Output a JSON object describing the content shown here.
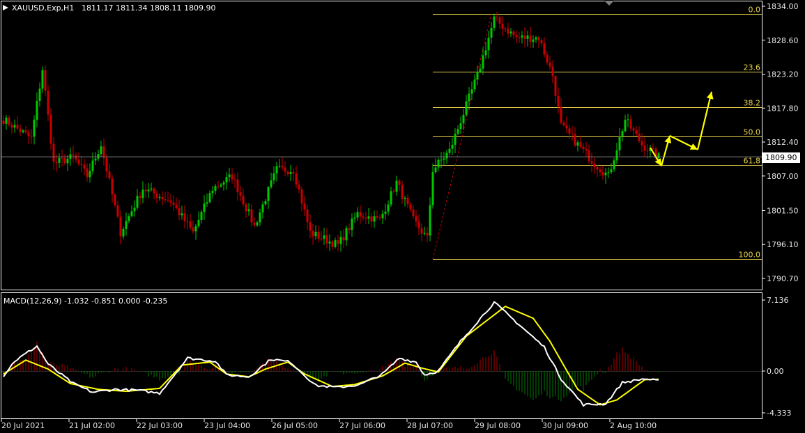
{
  "header": {
    "symbol": "XAUUSD.Exp,H1",
    "ohlc": "1811.17 1811.34 1808.11 1809.90"
  },
  "macd": {
    "label": "MACD(12,26,9) -1.032 -0.851 0.000 -0.235",
    "axis_labels": [
      "7.136",
      "0.00",
      "-4.333"
    ]
  },
  "price_axis_labels": [
    "1834.00",
    "1828.60",
    "1823.20",
    "1817.80",
    "1812.40",
    "1807.00",
    "1801.50",
    "1796.10",
    "1790.70"
  ],
  "current_price": "1809.90",
  "fibonacci": [
    {
      "label": "0.0",
      "price": 1832.8
    },
    {
      "label": "23.6",
      "price": 1823.6
    },
    {
      "label": "38.2",
      "price": 1817.9
    },
    {
      "label": "50.0",
      "price": 1813.3
    },
    {
      "label": "61.8",
      "price": 1808.7
    },
    {
      "label": "100.0",
      "price": 1793.8
    }
  ],
  "time_labels": [
    "20 Jul 2021",
    "21 Jul 02:00",
    "22 Jul 03:00",
    "23 Jul 04:00",
    "26 Jul 05:00",
    "27 Jul 06:00",
    "28 Jul 07:00",
    "29 Jul 08:00",
    "30 Jul 09:00",
    "2 Aug 10:00"
  ],
  "colors": {
    "background": "#000000",
    "bull": "#00c800",
    "bear": "#c80000",
    "fib": "#e8d24a",
    "arrows": "#ffff00",
    "macd_line": "#ffffff",
    "signal_line": "#ffff00",
    "grid": "#ffffff"
  },
  "chart_data": [
    {
      "type": "candlestick",
      "title": "XAUUSD.Exp,H1",
      "timeframe": "H1",
      "ylim": [
        1789.8,
        1834.6
      ],
      "grid": false,
      "anchors": [
        {
          "i": 0,
          "p": 1816
        },
        {
          "i": 10,
          "p": 1813
        },
        {
          "i": 14,
          "p": 1824
        },
        {
          "i": 18,
          "p": 1809
        },
        {
          "i": 25,
          "p": 1810
        },
        {
          "i": 30,
          "p": 1807
        },
        {
          "i": 35,
          "p": 1812
        },
        {
          "i": 42,
          "p": 1798
        },
        {
          "i": 50,
          "p": 1805
        },
        {
          "i": 60,
          "p": 1803
        },
        {
          "i": 68,
          "p": 1798
        },
        {
          "i": 75,
          "p": 1805
        },
        {
          "i": 82,
          "p": 1807
        },
        {
          "i": 90,
          "p": 1799
        },
        {
          "i": 98,
          "p": 1808
        },
        {
          "i": 104,
          "p": 1808
        },
        {
          "i": 110,
          "p": 1798
        },
        {
          "i": 120,
          "p": 1796
        },
        {
          "i": 127,
          "p": 1801
        },
        {
          "i": 135,
          "p": 1800
        },
        {
          "i": 141,
          "p": 1806
        },
        {
          "i": 147,
          "p": 1800
        },
        {
          "i": 152,
          "p": 1797
        },
        {
          "i": 154,
          "p": 1808
        },
        {
          "i": 160,
          "p": 1811
        },
        {
          "i": 165,
          "p": 1817
        },
        {
          "i": 170,
          "p": 1823
        },
        {
          "i": 176,
          "p": 1832
        },
        {
          "i": 184,
          "p": 1829
        },
        {
          "i": 192,
          "p": 1829
        },
        {
          "i": 197,
          "p": 1823
        },
        {
          "i": 200,
          "p": 1815
        },
        {
          "i": 206,
          "p": 1812
        },
        {
          "i": 212,
          "p": 1809
        },
        {
          "i": 217,
          "p": 1807
        },
        {
          "i": 223,
          "p": 1816
        },
        {
          "i": 229,
          "p": 1812
        },
        {
          "i": 235,
          "p": 1810
        }
      ],
      "annotations": [
        {
          "type": "arrow",
          "from": [
            232,
            1811.5
          ],
          "to": [
            236,
            1808.6
          ]
        },
        {
          "type": "arrow",
          "from": [
            236,
            1808.6
          ],
          "to": [
            239,
            1813.4
          ]
        },
        {
          "type": "arrow",
          "from": [
            239,
            1813.4
          ],
          "to": [
            249,
            1811.2
          ]
        },
        {
          "type": "arrow",
          "from": [
            249,
            1811.2
          ],
          "to": [
            254,
            1820.4
          ]
        }
      ]
    },
    {
      "type": "line",
      "title": "MACD(12,26,9)",
      "series": [
        {
          "name": "MACD",
          "color": "#ffffff"
        },
        {
          "name": "Signal",
          "color": "#ffff00"
        }
      ],
      "ylim": [
        -4.333,
        7.136
      ],
      "macd_anchors": [
        {
          "i": 0,
          "v": -0.5
        },
        {
          "i": 4,
          "v": 1.0
        },
        {
          "i": 12,
          "v": 2.5
        },
        {
          "i": 16,
          "v": 0.7
        },
        {
          "i": 25,
          "v": -1.3
        },
        {
          "i": 32,
          "v": -2.2
        },
        {
          "i": 40,
          "v": -1.9
        },
        {
          "i": 48,
          "v": -2.0
        },
        {
          "i": 56,
          "v": -2.3
        },
        {
          "i": 66,
          "v": 1.3
        },
        {
          "i": 76,
          "v": 1.0
        },
        {
          "i": 80,
          "v": -0.4
        },
        {
          "i": 88,
          "v": -0.6
        },
        {
          "i": 96,
          "v": 1.2
        },
        {
          "i": 103,
          "v": 0.9
        },
        {
          "i": 112,
          "v": -1.5
        },
        {
          "i": 120,
          "v": -1.7
        },
        {
          "i": 128,
          "v": -1.4
        },
        {
          "i": 136,
          "v": -0.3
        },
        {
          "i": 142,
          "v": 1.3
        },
        {
          "i": 148,
          "v": 0.9
        },
        {
          "i": 151,
          "v": -0.4
        },
        {
          "i": 156,
          "v": 0.0
        },
        {
          "i": 164,
          "v": 3.0
        },
        {
          "i": 176,
          "v": 6.9
        },
        {
          "i": 186,
          "v": 4.4
        },
        {
          "i": 194,
          "v": 2.4
        },
        {
          "i": 200,
          "v": -0.8
        },
        {
          "i": 208,
          "v": -3.5
        },
        {
          "i": 216,
          "v": -3.4
        },
        {
          "i": 222,
          "v": -1.2
        },
        {
          "i": 230,
          "v": -0.8
        },
        {
          "i": 235,
          "v": -1.03
        }
      ],
      "signal_anchors": [
        {
          "i": 0,
          "v": -0.3
        },
        {
          "i": 8,
          "v": 1.1
        },
        {
          "i": 16,
          "v": 0.2
        },
        {
          "i": 24,
          "v": -1.3
        },
        {
          "i": 34,
          "v": -1.9
        },
        {
          "i": 44,
          "v": -2.1
        },
        {
          "i": 56,
          "v": -1.8
        },
        {
          "i": 64,
          "v": 0.6
        },
        {
          "i": 74,
          "v": 0.9
        },
        {
          "i": 80,
          "v": -0.3
        },
        {
          "i": 88,
          "v": -0.6
        },
        {
          "i": 94,
          "v": 0.2
        },
        {
          "i": 102,
          "v": 0.9
        },
        {
          "i": 108,
          "v": -0.3
        },
        {
          "i": 118,
          "v": -1.6
        },
        {
          "i": 126,
          "v": -1.4
        },
        {
          "i": 136,
          "v": -0.5
        },
        {
          "i": 144,
          "v": 0.8
        },
        {
          "i": 150,
          "v": 0.3
        },
        {
          "i": 156,
          "v": -0.1
        },
        {
          "i": 166,
          "v": 3.5
        },
        {
          "i": 180,
          "v": 6.5
        },
        {
          "i": 190,
          "v": 5.3
        },
        {
          "i": 196,
          "v": 3.0
        },
        {
          "i": 206,
          "v": -1.9
        },
        {
          "i": 214,
          "v": -3.5
        },
        {
          "i": 220,
          "v": -3.0
        },
        {
          "i": 230,
          "v": -0.9
        },
        {
          "i": 235,
          "v": -0.85
        }
      ]
    }
  ]
}
